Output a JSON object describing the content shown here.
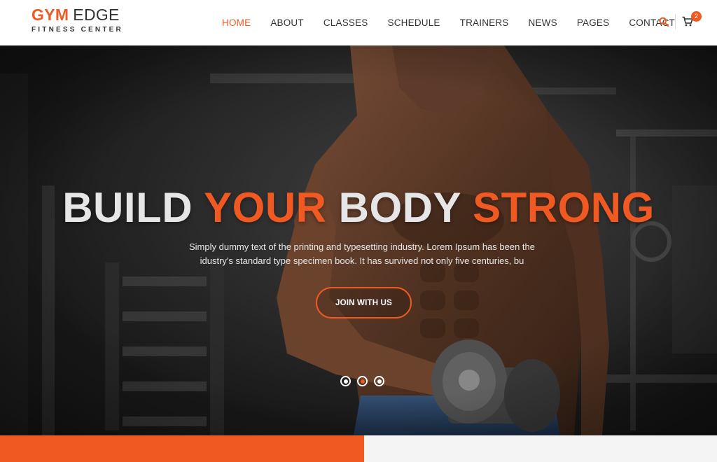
{
  "brand": {
    "name_part1": "GYM",
    "name_part2": "EDGE",
    "tagline": "FITNESS CENTER"
  },
  "nav": {
    "items": [
      {
        "label": "HOME",
        "active": true
      },
      {
        "label": "ABOUT",
        "active": false
      },
      {
        "label": "CLASSES",
        "active": false
      },
      {
        "label": "SCHEDULE",
        "active": false
      },
      {
        "label": "TRAINERS",
        "active": false
      },
      {
        "label": "NEWS",
        "active": false
      },
      {
        "label": "PAGES",
        "active": false
      },
      {
        "label": "CONTACT",
        "active": false
      }
    ],
    "search_icon": "search-icon",
    "cart_icon": "shopping-cart-icon",
    "cart_count": "2"
  },
  "hero": {
    "title_word1": "BUILD",
    "title_word2": "YOUR",
    "title_word3": "BODY",
    "title_word4": "STRONG",
    "text": "Simply dummy text of the printing and typesetting industry. Lorem Ipsum has been the idustry's standard type specimen book. It has survived not only five centuries, bu",
    "cta_label": "JOIN WITH US",
    "slides": 3,
    "active_slide": 2
  },
  "colors": {
    "accent": "#f05a22",
    "dark": "#333333",
    "light_strip": "#f4f4f4"
  }
}
